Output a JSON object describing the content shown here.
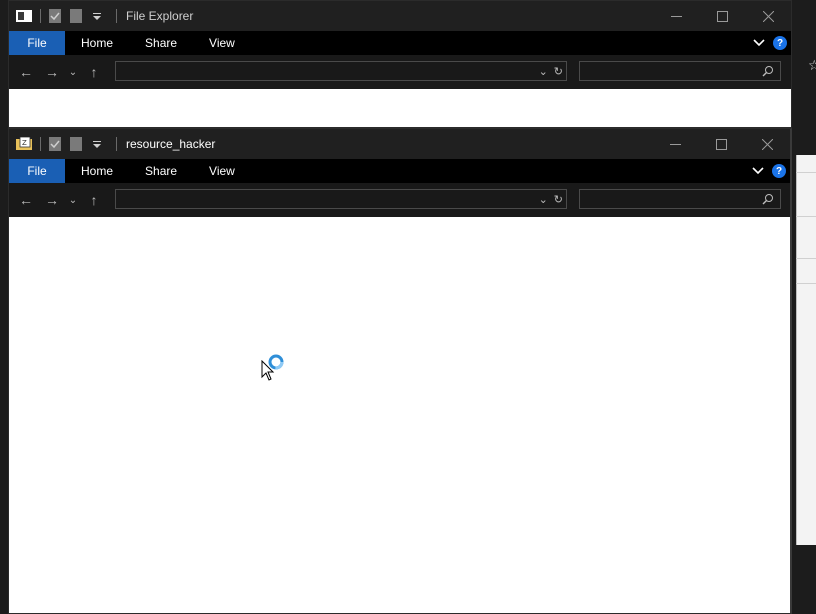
{
  "windows": {
    "back": {
      "title": "File Explorer",
      "tabs": [
        "File",
        "Home",
        "Share",
        "View"
      ],
      "address_value": "",
      "search_value": ""
    },
    "front": {
      "title": "resource_hacker",
      "tabs": [
        "File",
        "Home",
        "Share",
        "View"
      ],
      "address_value": "",
      "search_value": ""
    }
  },
  "colors": {
    "accent": "#1a5fb4",
    "titlebar": "#202020",
    "ribbon": "#000000",
    "navbar": "#191919",
    "help": "#1a73e8"
  },
  "icons": {
    "back": "arrow-left-icon",
    "forward": "arrow-right-icon",
    "recent": "chevron-down-icon",
    "up": "arrow-up-icon",
    "refresh": "refresh-icon",
    "search": "search-icon",
    "help": "help-icon",
    "busy": "busy-cursor-icon"
  }
}
